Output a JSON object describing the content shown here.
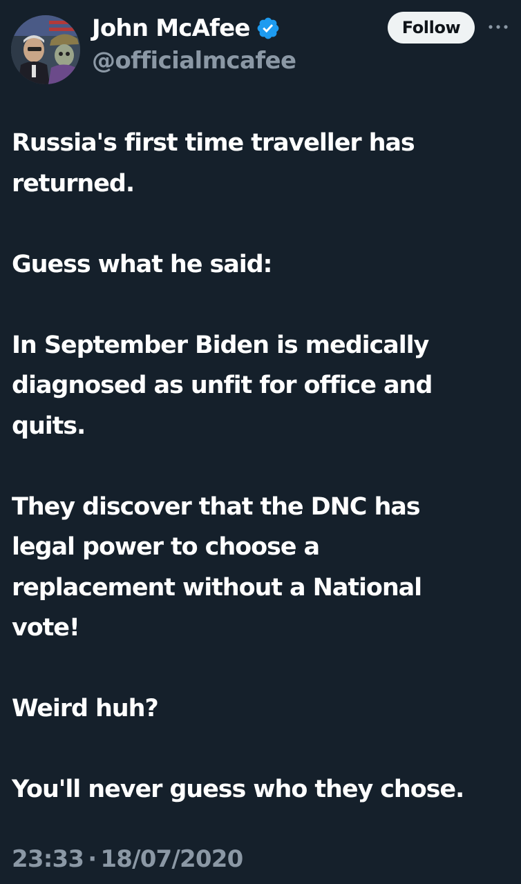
{
  "author": {
    "display_name": "John McAfee",
    "handle": "@officialmcafee",
    "verified": true,
    "avatar_icon": "profile-photo"
  },
  "actions": {
    "follow_label": "Follow",
    "more_icon": "ellipsis-icon"
  },
  "tweet": {
    "paragraphs": [
      "Russia's first time traveller has\nreturned.",
      "Guess what he said:",
      "In September Biden is medically\ndiagnosed as unfit for office and\nquits.",
      "They discover that the DNC has\nlegal power to choose a\nreplacement without a National\nvote!",
      "Weird huh?",
      "You'll never guess who they chose."
    ],
    "time": "23:33",
    "separator": "·",
    "date": "18/07/2020"
  },
  "colors": {
    "background": "#15202b",
    "text_primary": "#ffffff",
    "text_secondary": "#8b98a5",
    "verified_blue": "#1d9bf0",
    "follow_bg": "#eff3f4",
    "follow_text": "#0f1419"
  }
}
